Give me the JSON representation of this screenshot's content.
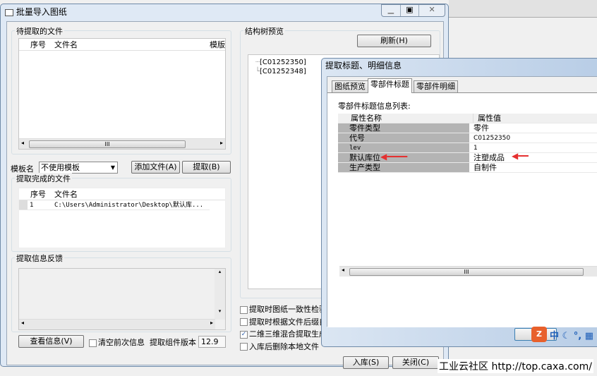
{
  "main_window": {
    "title": "批量导入图纸",
    "pending_group": {
      "label": "待提取的文件",
      "columns": [
        "序号",
        "文件名",
        "模版"
      ]
    },
    "template_label": "模板名",
    "template_value": "不使用模板",
    "add_file": "添加文件(A)",
    "extract": "提取(B)",
    "done_group": {
      "label": "提取完成的文件",
      "columns": [
        "序号",
        "文件名"
      ],
      "rows": [
        {
          "no": "1",
          "file": "C:\\Users\\Administrator\\Desktop\\默认库..."
        }
      ]
    },
    "feedback_group": {
      "label": "提取信息反馈"
    },
    "view_info": "查看信息(V)",
    "clear_prev": "清空前次信息",
    "version_label": "提取组件版本",
    "version_value": "12.9",
    "tree_group": {
      "label": "结构树预览",
      "refresh": "刷新(H)",
      "nodes": [
        "[C01252350]",
        "[C01252348]"
      ]
    },
    "options": [
      {
        "label": "提取时图纸一致性检验",
        "checked": false
      },
      {
        "label": "提取时根据文件后缀自",
        "checked": false
      },
      {
        "label": "二维三维混合提取生成",
        "checked": true
      },
      {
        "label": "入库后删除本地文件",
        "checked": false
      }
    ],
    "store": "入库(S)",
    "close": "关闭(C)"
  },
  "dialog": {
    "title": "提取标题、明细信息",
    "tabs": [
      "图纸预览",
      "零部件标题",
      "零部件明细"
    ],
    "active_tab": 1,
    "list_label": "零部件标题信息列表:",
    "columns": [
      "属性名称",
      "属性值"
    ],
    "rows": [
      {
        "name": "零件类型",
        "value": "零件"
      },
      {
        "name": "代号",
        "value": "C01252350"
      },
      {
        "name": "lev",
        "value": "1"
      },
      {
        "name": "默认库位",
        "value": "注塑成品"
      },
      {
        "name": "生产类型",
        "value": "自制件"
      }
    ],
    "ime": "中"
  },
  "watermark": "工业云社区 http://top.caxa.com/"
}
